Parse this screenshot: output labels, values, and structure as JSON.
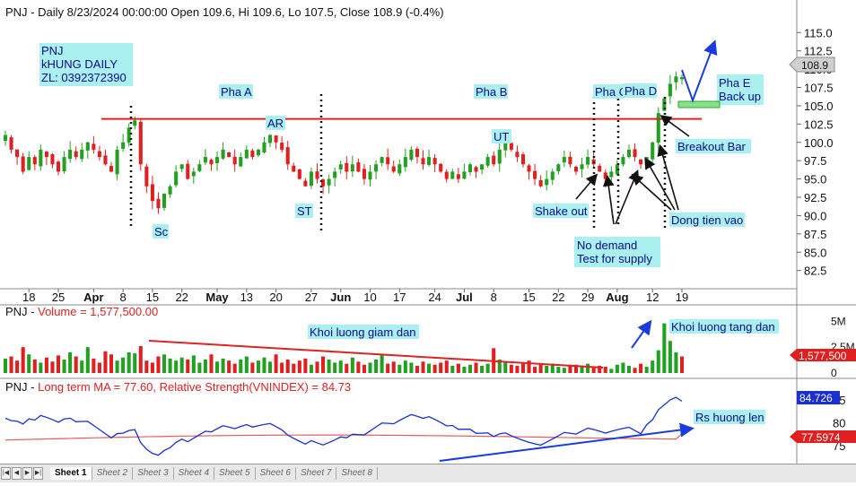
{
  "header": {
    "price_title": "PNJ - Daily 8/23/2024 00:00:00 Open 109.6, Hi 109.6, Lo 107.5, Close 108.9 (-0.4%)",
    "volume_title_prefix": "PNJ - ",
    "volume_title_value": "Volume = 1,577,500.00",
    "ma_title_prefix": "PNJ - ",
    "ma_title_value": "Long term MA = 77.60, Relative Strength(VNINDEX) = 84.73"
  },
  "badges": {
    "last_price": "108.9",
    "last_volume": "1,577,500",
    "rs_value": "84.726",
    "ma_value": "77.5974"
  },
  "annotations": {
    "ticker_box": [
      "PNJ",
      "kHUNG DAILY",
      "ZL: 0392372390"
    ],
    "pha_a": "Pha A",
    "pha_b": "Pha B",
    "pha_c": "Pha C",
    "pha_d": "Pha D",
    "pha_e": [
      "Pha E",
      "Back up"
    ],
    "ar": "AR",
    "sc": "Sc",
    "st": "ST",
    "ut": "UT",
    "shake_out": "Shake out",
    "no_demand": [
      "No demand",
      "Test for supply"
    ],
    "breakout_bar": "Breakout Bar",
    "dong_tien": "Dong tien vao",
    "khoi_giam": "Khoi luong giam dan",
    "khoi_tang": "Khoi luong tang dan",
    "rs_huong": "Rs huong len"
  },
  "colors": {
    "up": "#22a022",
    "down": "#e02020",
    "resistance": "#dd2222",
    "annotation_bg": "#aaf0f0",
    "arrow_blue": "#1a3cdc",
    "rs_line": "#1a2fd0",
    "ma_line": "#e06060",
    "backup_box": "#88e088"
  },
  "tabs": [
    "Sheet 1",
    "Sheet 2",
    "Sheet 3",
    "Sheet 4",
    "Sheet 5",
    "Sheet 6",
    "Sheet 7",
    "Sheet 8"
  ],
  "tab_nav": [
    "|◀",
    "◀",
    "▶",
    "▶|"
  ],
  "chart_data": [
    {
      "type": "candlestick",
      "title": "PNJ - Daily 8/23/2024",
      "x_ticks": [
        "18",
        "25",
        "Apr",
        "8",
        "15",
        "22",
        "May",
        "13",
        "20",
        "27",
        "Jun",
        "10",
        "17",
        "24",
        "Jul",
        "8",
        "15",
        "22",
        "29",
        "Aug",
        "12",
        "19"
      ],
      "y_ticks": [
        82.5,
        85.0,
        87.5,
        90.0,
        92.5,
        95.0,
        97.5,
        100.0,
        102.5,
        105.0,
        107.5,
        110.0,
        112.5,
        115.0
      ],
      "ylim": [
        80.5,
        116.5
      ],
      "resistance_level": 103.2,
      "last": {
        "open": 109.6,
        "high": 109.6,
        "low": 107.5,
        "close": 108.9
      },
      "closes": [
        101,
        99,
        98,
        96,
        98,
        97,
        99,
        98,
        97,
        96,
        98,
        99,
        98,
        99,
        100,
        99,
        98,
        97,
        96,
        99,
        100,
        102,
        103,
        97,
        94,
        92,
        91,
        93,
        94,
        96,
        97,
        95,
        96,
        97,
        98,
        97,
        98,
        99,
        98,
        97,
        98,
        99,
        98,
        99,
        100,
        101,
        100,
        99,
        97,
        96,
        95,
        94,
        96,
        95,
        94,
        95,
        96,
        97,
        96,
        97,
        96,
        95,
        96,
        97,
        98,
        97,
        96,
        97,
        98,
        99,
        98,
        97,
        98,
        97,
        96,
        95,
        96,
        95,
        96,
        97,
        96,
        97,
        98,
        97,
        99,
        100,
        99,
        98,
        97,
        96,
        95,
        94,
        95,
        96,
        97,
        98,
        97,
        96,
        97,
        98,
        97,
        96,
        95,
        96,
        97,
        98,
        99,
        98,
        97,
        98,
        100,
        104,
        106,
        108,
        109,
        108.9
      ],
      "volume": {
        "ylim": [
          0,
          5200000
        ],
        "y_ticks": [
          "5M",
          "2.5M",
          "0"
        ],
        "values": [
          1.4,
          1.6,
          1.2,
          2.5,
          1.8,
          1.3,
          1.0,
          1.5,
          1.1,
          1.7,
          1.3,
          2.0,
          1.6,
          1.2,
          2.5,
          1.4,
          1.0,
          2.1,
          1.8,
          1.2,
          1.5,
          2.0,
          1.9,
          2.6,
          1.2,
          1.0,
          1.6,
          1.8,
          1.4,
          1.2,
          1.5,
          1.3,
          1.7,
          1.0,
          1.3,
          1.8,
          1.1,
          1.4,
          1.2,
          0.9,
          1.3,
          1.6,
          1.0,
          1.2,
          1.5,
          1.1,
          1.8,
          1.0,
          1.3,
          0.9,
          1.2,
          1.4,
          0.8,
          1.1,
          1.6,
          1.3,
          1.0,
          1.2,
          0.9,
          1.5,
          1.1,
          0.8,
          1.0,
          1.3,
          1.7,
          0.9,
          1.1,
          0.8,
          1.2,
          1.0,
          0.7,
          1.1,
          0.9,
          0.8,
          1.0,
          1.2,
          0.7,
          0.9,
          0.6,
          0.8,
          1.0,
          0.7,
          0.9,
          2.4,
          1.3,
          1.1,
          0.8,
          0.7,
          0.9,
          1.2,
          0.6,
          0.8,
          0.7,
          0.9,
          0.6,
          0.5,
          0.7,
          0.8,
          0.6,
          0.9,
          0.5,
          0.7,
          0.6,
          0.4,
          0.8,
          1.0,
          0.7,
          0.5,
          0.9,
          0.6,
          1.2,
          2.2,
          4.8,
          3.1,
          2.0,
          1.6
        ]
      }
    },
    {
      "type": "line",
      "series": [
        {
          "name": "Long term MA",
          "last": 77.5974
        },
        {
          "name": "Relative Strength(VNINDEX)",
          "last": 84.726
        }
      ],
      "y_ticks": [
        75,
        80,
        85
      ],
      "ylim": [
        72,
        87
      ]
    }
  ]
}
